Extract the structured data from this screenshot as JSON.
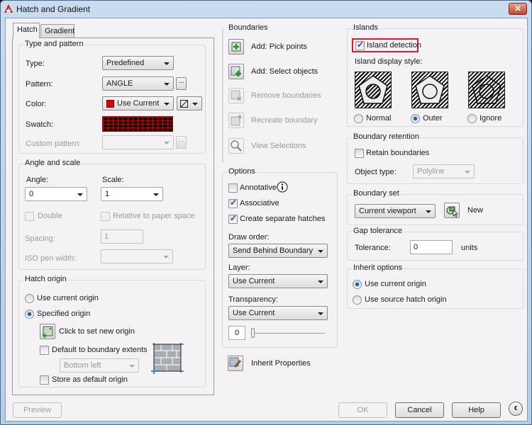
{
  "window": {
    "title": "Hatch and Gradient",
    "close_label": "✕"
  },
  "tabs": [
    {
      "label": "Hatch",
      "active": true
    },
    {
      "label": "Gradient",
      "active": false
    }
  ],
  "type_pattern": {
    "title": "Type and pattern",
    "type_label": "Type:",
    "type_value": "Predefined",
    "pattern_label": "Pattern:",
    "pattern_value": "ANGLE",
    "pattern_browse": "...",
    "color_label": "Color:",
    "color_value": "Use Current",
    "color_swatch": "#e00000",
    "swatch_label": "Swatch:",
    "custom_label": "Custom pattern:",
    "custom_value": "",
    "custom_browse": "..."
  },
  "angle_scale": {
    "title": "Angle and scale",
    "angle_label": "Angle:",
    "angle_value": "0",
    "scale_label": "Scale:",
    "scale_value": "1",
    "double_label": "Double",
    "double_checked": false,
    "relative_label": "Relative to paper space",
    "relative_checked": false,
    "spacing_label": "Spacing:",
    "spacing_value": "1",
    "iso_label": "ISO pen width:",
    "iso_value": ""
  },
  "hatch_origin": {
    "title": "Hatch origin",
    "use_current_label": "Use current origin",
    "specified_label": "Specified origin",
    "selected": "specified",
    "click_set_label": "Click to set new origin",
    "default_extents_label": "Default to boundary extents",
    "default_extents_checked": false,
    "position_value": "Bottom left",
    "store_default_label": "Store as default origin",
    "store_default_checked": false
  },
  "preview_label": "Preview",
  "boundaries": {
    "title": "Boundaries",
    "items": [
      {
        "label": "Add: Pick points",
        "enabled": true
      },
      {
        "label": "Add: Select objects",
        "enabled": true
      },
      {
        "label": "Remove boundaries",
        "enabled": false
      },
      {
        "label": "Recreate boundary",
        "enabled": false
      },
      {
        "label": "View Selections",
        "enabled": false
      }
    ]
  },
  "options": {
    "title": "Options",
    "annotative_label": "Annotative",
    "annotative_checked": false,
    "associative_label": "Associative",
    "associative_checked": true,
    "separate_label": "Create separate hatches",
    "separate_checked": true,
    "draw_order_label": "Draw order:",
    "draw_order_value": "Send Behind Boundary",
    "layer_label": "Layer:",
    "layer_value": "Use Current",
    "transparency_label": "Transparency:",
    "transparency_value": "Use Current",
    "transparency_amount": "0",
    "transparency_fraction": 0
  },
  "inherit_properties_label": "Inherit Properties",
  "islands": {
    "title": "Islands",
    "detection_label": "Island detection",
    "detection_checked": true,
    "display_style_label": "Island display style:",
    "styles": [
      {
        "label": "Normal"
      },
      {
        "label": "Outer"
      },
      {
        "label": "Ignore"
      }
    ],
    "selected": "Outer"
  },
  "boundary_retention": {
    "title": "Boundary retention",
    "retain_label": "Retain boundaries",
    "retain_checked": false,
    "object_type_label": "Object type:",
    "object_type_value": "Polyline"
  },
  "boundary_set": {
    "title": "Boundary set",
    "value": "Current viewport",
    "new_label": "New"
  },
  "gap_tolerance": {
    "title": "Gap tolerance",
    "label": "Tolerance:",
    "value": "0",
    "units": "units"
  },
  "inherit_options": {
    "title": "Inherit options",
    "use_current_label": "Use current origin",
    "use_source_label": "Use source hatch origin",
    "selected": "current"
  },
  "buttons": {
    "ok": "OK",
    "cancel": "Cancel",
    "help": "Help",
    "collapse": "‹"
  },
  "colors": {
    "highlight": "#d81e2a",
    "accent": "#1a5aa8"
  }
}
